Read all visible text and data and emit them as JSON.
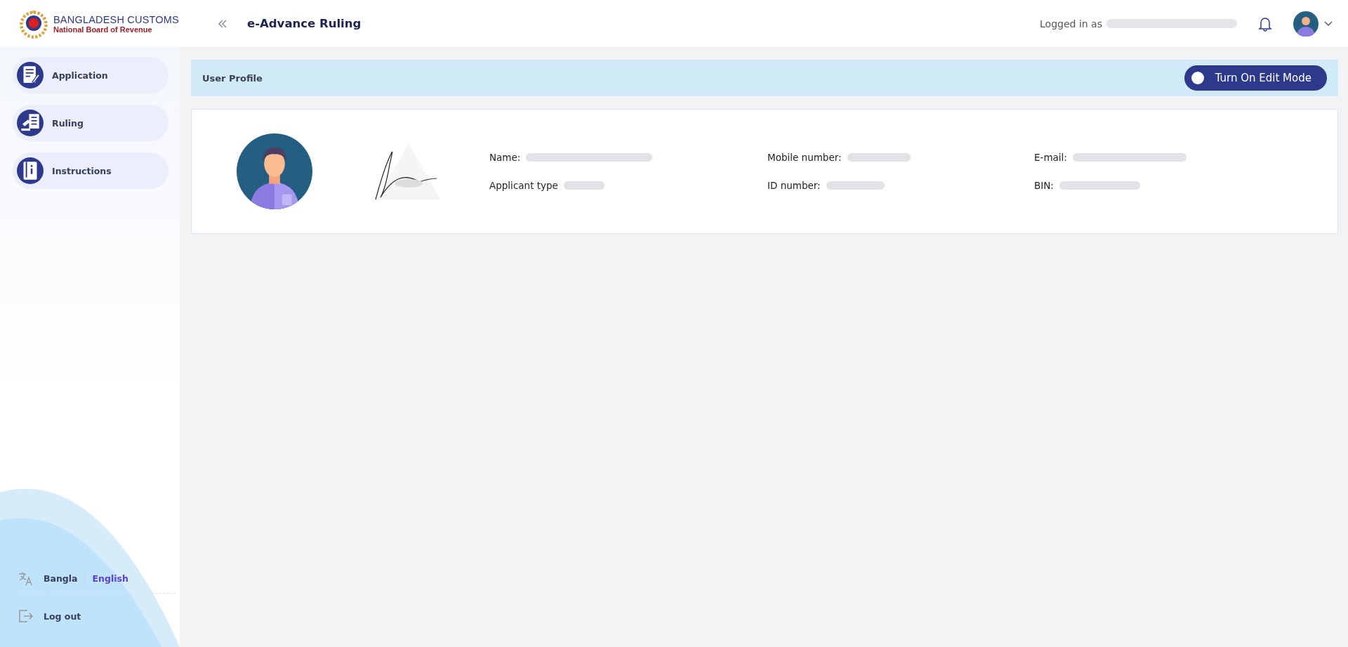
{
  "header": {
    "logo_title": "BANGLADESH CUSTOMS",
    "logo_subtitle": "National Board of Revenue",
    "app_title": "e-Advance Ruling",
    "logged_in_label": "Logged in as",
    "logged_in_user_redacted": true
  },
  "sidebar": {
    "items": [
      {
        "label": "Application",
        "selected": false
      },
      {
        "label": "Ruling",
        "selected": false
      },
      {
        "label": "Instructions",
        "selected": false
      }
    ],
    "languages": [
      {
        "label": "Bangla",
        "selected": false
      },
      {
        "label": "English",
        "selected": true
      }
    ],
    "logout": "Log out"
  },
  "profile_bar": {
    "title": "User Profile",
    "edit_toggle": {
      "label": "Turn On Edit Mode",
      "on": false
    }
  },
  "profile_card": {
    "fields": [
      {
        "label": "Name:",
        "redacted": true
      },
      {
        "label": "Mobile number:",
        "redacted": true
      },
      {
        "label": "E-mail:",
        "redacted": true
      },
      {
        "label": "Applicant type",
        "redacted": true
      },
      {
        "label": "ID number:",
        "redacted": true
      },
      {
        "label": "BIN:",
        "redacted": true
      }
    ]
  }
}
